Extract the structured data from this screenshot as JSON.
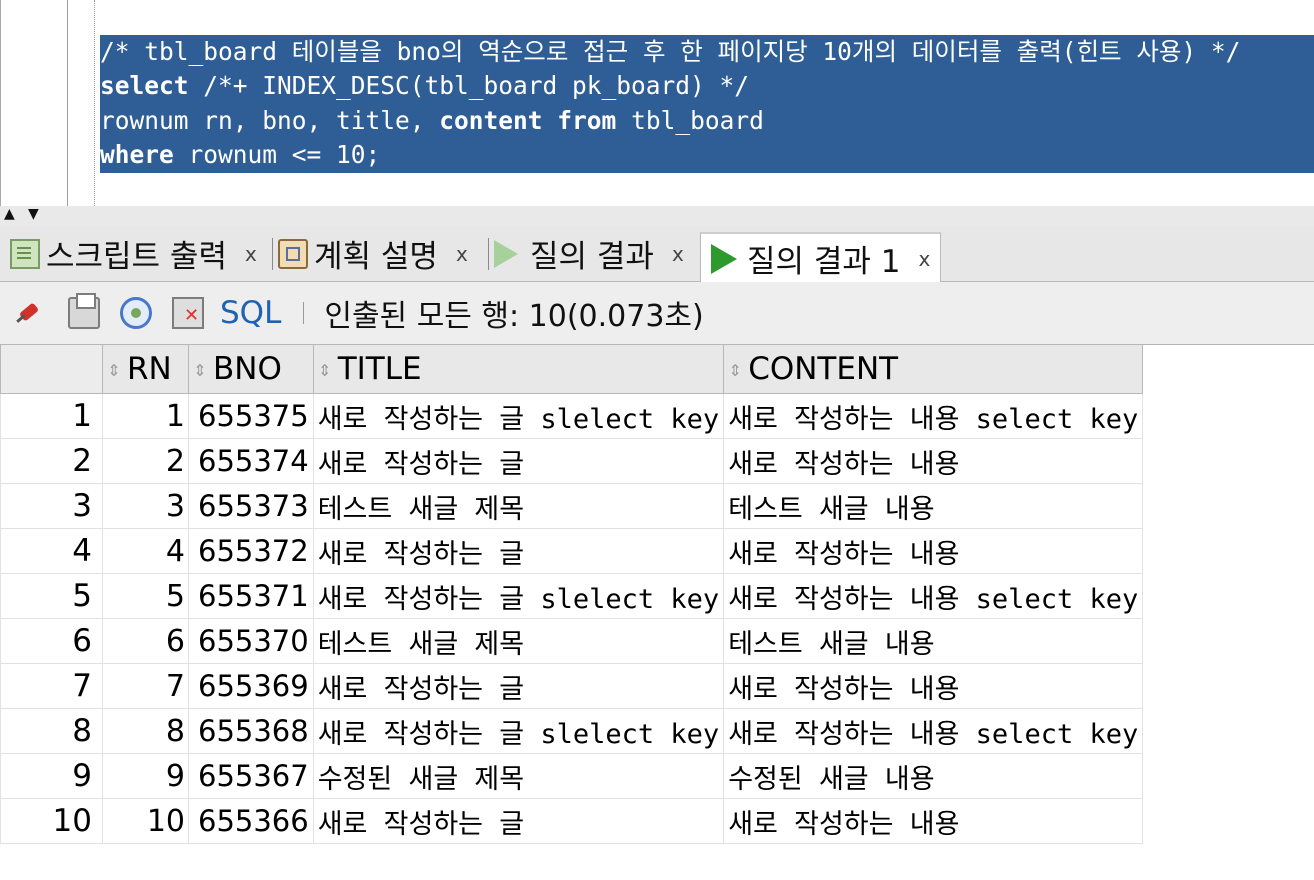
{
  "editor": {
    "lines": [
      [
        {
          "t": "/* tbl_board 테이블을 bno의 역순으로 접근 후 한 페이지당 10개의 데이터를 출력(힌트 사용) */",
          "kw": false
        }
      ],
      [
        {
          "t": "select",
          "kw": true
        },
        {
          "t": " /*+ INDEX_DESC(tbl_board pk_board) */",
          "kw": false
        }
      ],
      [
        {
          "t": "rownum rn, bno, title, ",
          "kw": false
        },
        {
          "t": "content",
          "kw": true
        },
        {
          "t": " ",
          "kw": false
        },
        {
          "t": "from",
          "kw": true
        },
        {
          "t": " tbl_board",
          "kw": false
        }
      ],
      [
        {
          "t": "where",
          "kw": true
        },
        {
          "t": " rownum <= 10;",
          "kw": false
        }
      ]
    ],
    "selection_color": "#2f5e96"
  },
  "tabs": [
    {
      "label": "스크립트 출력",
      "close": "x",
      "icon": "script-output-icon"
    },
    {
      "label": "계획 설명",
      "close": "x",
      "icon": "explain-plan-icon"
    },
    {
      "label": "질의 결과",
      "close": "x",
      "icon": "query-result-icon"
    },
    {
      "label": "질의 결과 1",
      "close": "x",
      "icon": "query-result-active-icon"
    }
  ],
  "toolbar": {
    "sql_label": "SQL",
    "status": "인출된 모든 행: 10(0.073초)"
  },
  "grid": {
    "columns": [
      "RN",
      "BNO",
      "TITLE",
      "CONTENT"
    ],
    "rows": [
      {
        "num": "1",
        "rn": "1",
        "bno": "655375",
        "title": "새로 작성하는 글 slelect key",
        "content": "새로 작성하는 내용 select key"
      },
      {
        "num": "2",
        "rn": "2",
        "bno": "655374",
        "title": "새로 작성하는 글",
        "content": "새로 작성하는 내용"
      },
      {
        "num": "3",
        "rn": "3",
        "bno": "655373",
        "title": "테스트 새글 제목",
        "content": "테스트 새글 내용"
      },
      {
        "num": "4",
        "rn": "4",
        "bno": "655372",
        "title": "새로 작성하는 글",
        "content": "새로 작성하는 내용"
      },
      {
        "num": "5",
        "rn": "5",
        "bno": "655371",
        "title": "새로 작성하는 글 slelect key",
        "content": "새로 작성하는 내용 select key"
      },
      {
        "num": "6",
        "rn": "6",
        "bno": "655370",
        "title": "테스트 새글 제목",
        "content": "테스트 새글 내용"
      },
      {
        "num": "7",
        "rn": "7",
        "bno": "655369",
        "title": "새로 작성하는 글",
        "content": "새로 작성하는 내용"
      },
      {
        "num": "8",
        "rn": "8",
        "bno": "655368",
        "title": "새로 작성하는 글 slelect key",
        "content": "새로 작성하는 내용 select key"
      },
      {
        "num": "9",
        "rn": "9",
        "bno": "655367",
        "title": "수정된 새글 제목",
        "content": "수정된 새글 내용"
      },
      {
        "num": "10",
        "rn": "10",
        "bno": "655366",
        "title": "새로 작성하는 글",
        "content": "새로 작성하는 내용"
      }
    ]
  }
}
